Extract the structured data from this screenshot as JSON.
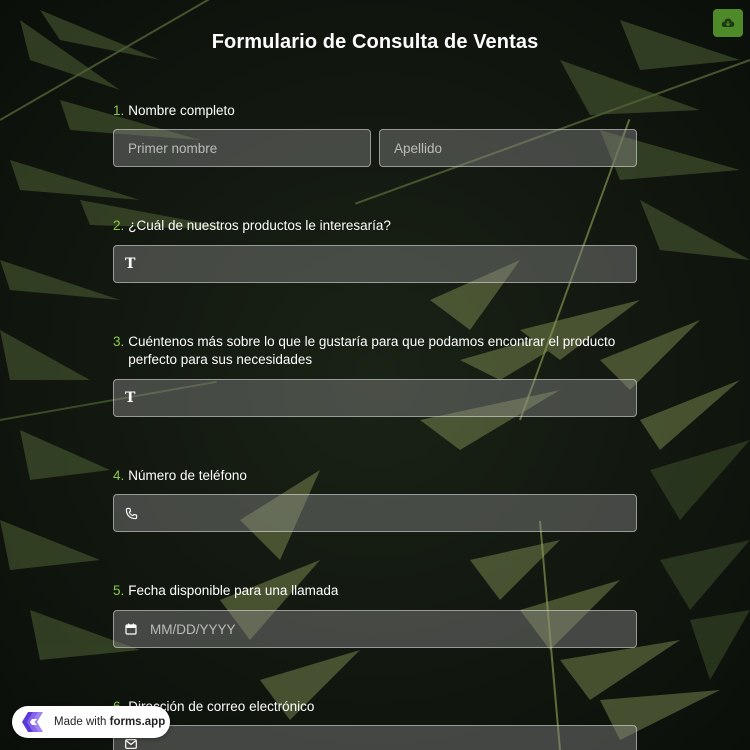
{
  "header": {
    "title": "Formulario de Consulta de Ventas",
    "save_icon": "cloud-save-icon",
    "accent_color": "#8cc84b"
  },
  "questions": [
    {
      "number": "1.",
      "label": "Nombre completo",
      "fields": [
        {
          "placeholder": "Primer nombre",
          "icon": "none"
        },
        {
          "placeholder": "Apellido",
          "icon": "none"
        }
      ]
    },
    {
      "number": "2.",
      "label": "¿Cuál de nuestros productos le interesaría?",
      "fields": [
        {
          "placeholder": "",
          "icon": "text-icon",
          "icon_glyph": "T"
        }
      ]
    },
    {
      "number": "3.",
      "label": "Cuéntenos más sobre lo que le gustaría para que podamos encontrar el producto perfecto para sus necesidades",
      "fields": [
        {
          "placeholder": "",
          "icon": "text-icon",
          "icon_glyph": "T"
        }
      ]
    },
    {
      "number": "4.",
      "label": "Número de teléfono",
      "fields": [
        {
          "placeholder": "",
          "icon": "phone-icon"
        }
      ]
    },
    {
      "number": "5.",
      "label": "Fecha disponible para una llamada",
      "fields": [
        {
          "placeholder": "MM/DD/YYYY",
          "icon": "calendar-icon"
        }
      ]
    },
    {
      "number": "6.",
      "label": "Dirección de correo electrónico",
      "fields": [
        {
          "placeholder": "",
          "icon": "email-icon"
        }
      ]
    }
  ],
  "badge": {
    "prefix": "Made with",
    "brand": "forms.app",
    "icon": "forms-app-logo"
  }
}
